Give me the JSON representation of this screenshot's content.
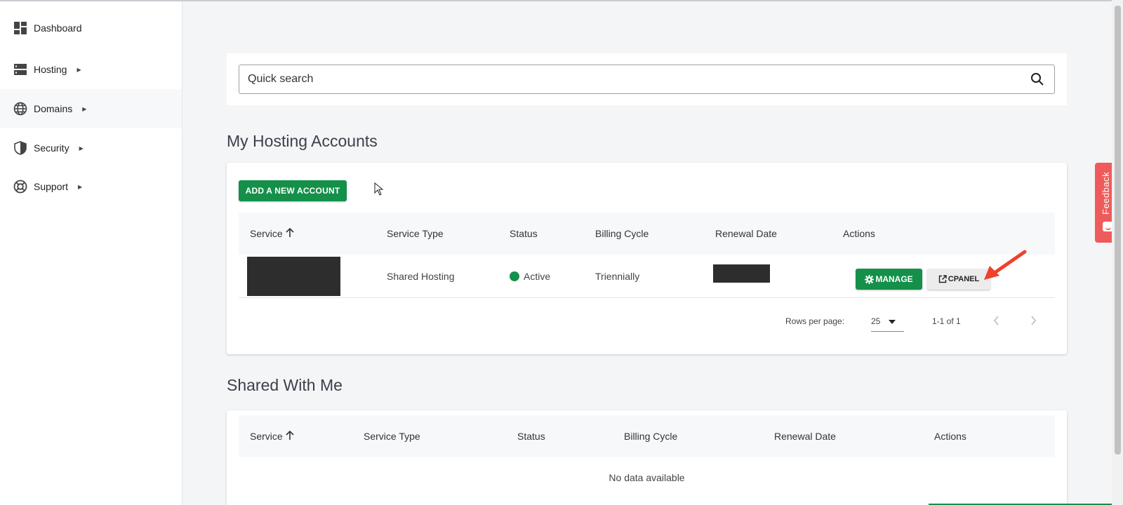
{
  "sidebar": {
    "items": [
      {
        "label": "Dashboard",
        "icon": "dashboard-icon"
      },
      {
        "label": "Hosting",
        "icon": "server-icon"
      },
      {
        "label": "Domains",
        "icon": "globe-icon"
      },
      {
        "label": "Security",
        "icon": "shield-icon"
      },
      {
        "label": "Support",
        "icon": "lifebuoy-icon"
      }
    ]
  },
  "search": {
    "placeholder": "Quick search"
  },
  "hosting": {
    "title": "My Hosting Accounts",
    "add_button": "ADD A NEW ACCOUNT",
    "columns": [
      "Service",
      "Service Type",
      "Status",
      "Billing Cycle",
      "Renewal Date",
      "Actions"
    ],
    "rows": [
      {
        "service": "",
        "service_type": "Shared Hosting",
        "status": "Active",
        "billing_cycle": "Triennially",
        "renewal_date": ""
      }
    ],
    "manage_label": "MANAGE",
    "cpanel_label": "CPANEL",
    "pager": {
      "rows_per_page_label": "Rows per page:",
      "rows_per_page_value": "25",
      "range": "1-1 of 1"
    }
  },
  "shared": {
    "title": "Shared With Me",
    "columns": [
      "Service",
      "Service Type",
      "Status",
      "Billing Cycle",
      "Renewal Date",
      "Actions"
    ],
    "empty_text": "No data available"
  },
  "feedback": {
    "label": "Feedback"
  },
  "colors": {
    "primary_green": "#14904a",
    "feedback_red": "#ef5b5b",
    "annotation_arrow": "#f0412a"
  }
}
